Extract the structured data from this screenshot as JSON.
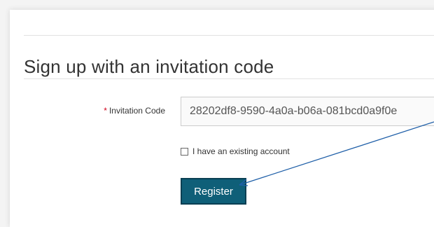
{
  "form": {
    "title": "Sign up with an invitation code",
    "invitation_label": "Invitation Code",
    "required_marker": "*",
    "invitation_value": "28202df8-9590-4a0a-b06a-081bcd0a9f0e",
    "existing_account_label": "I have an existing account",
    "existing_account_checked": false,
    "register_label": "Register"
  },
  "colors": {
    "accent": "#0f5f78",
    "required": "#d0021b",
    "annotation_arrow": "#1f5fa8"
  },
  "annotation": {
    "icon": "arrow-annotation-icon"
  }
}
